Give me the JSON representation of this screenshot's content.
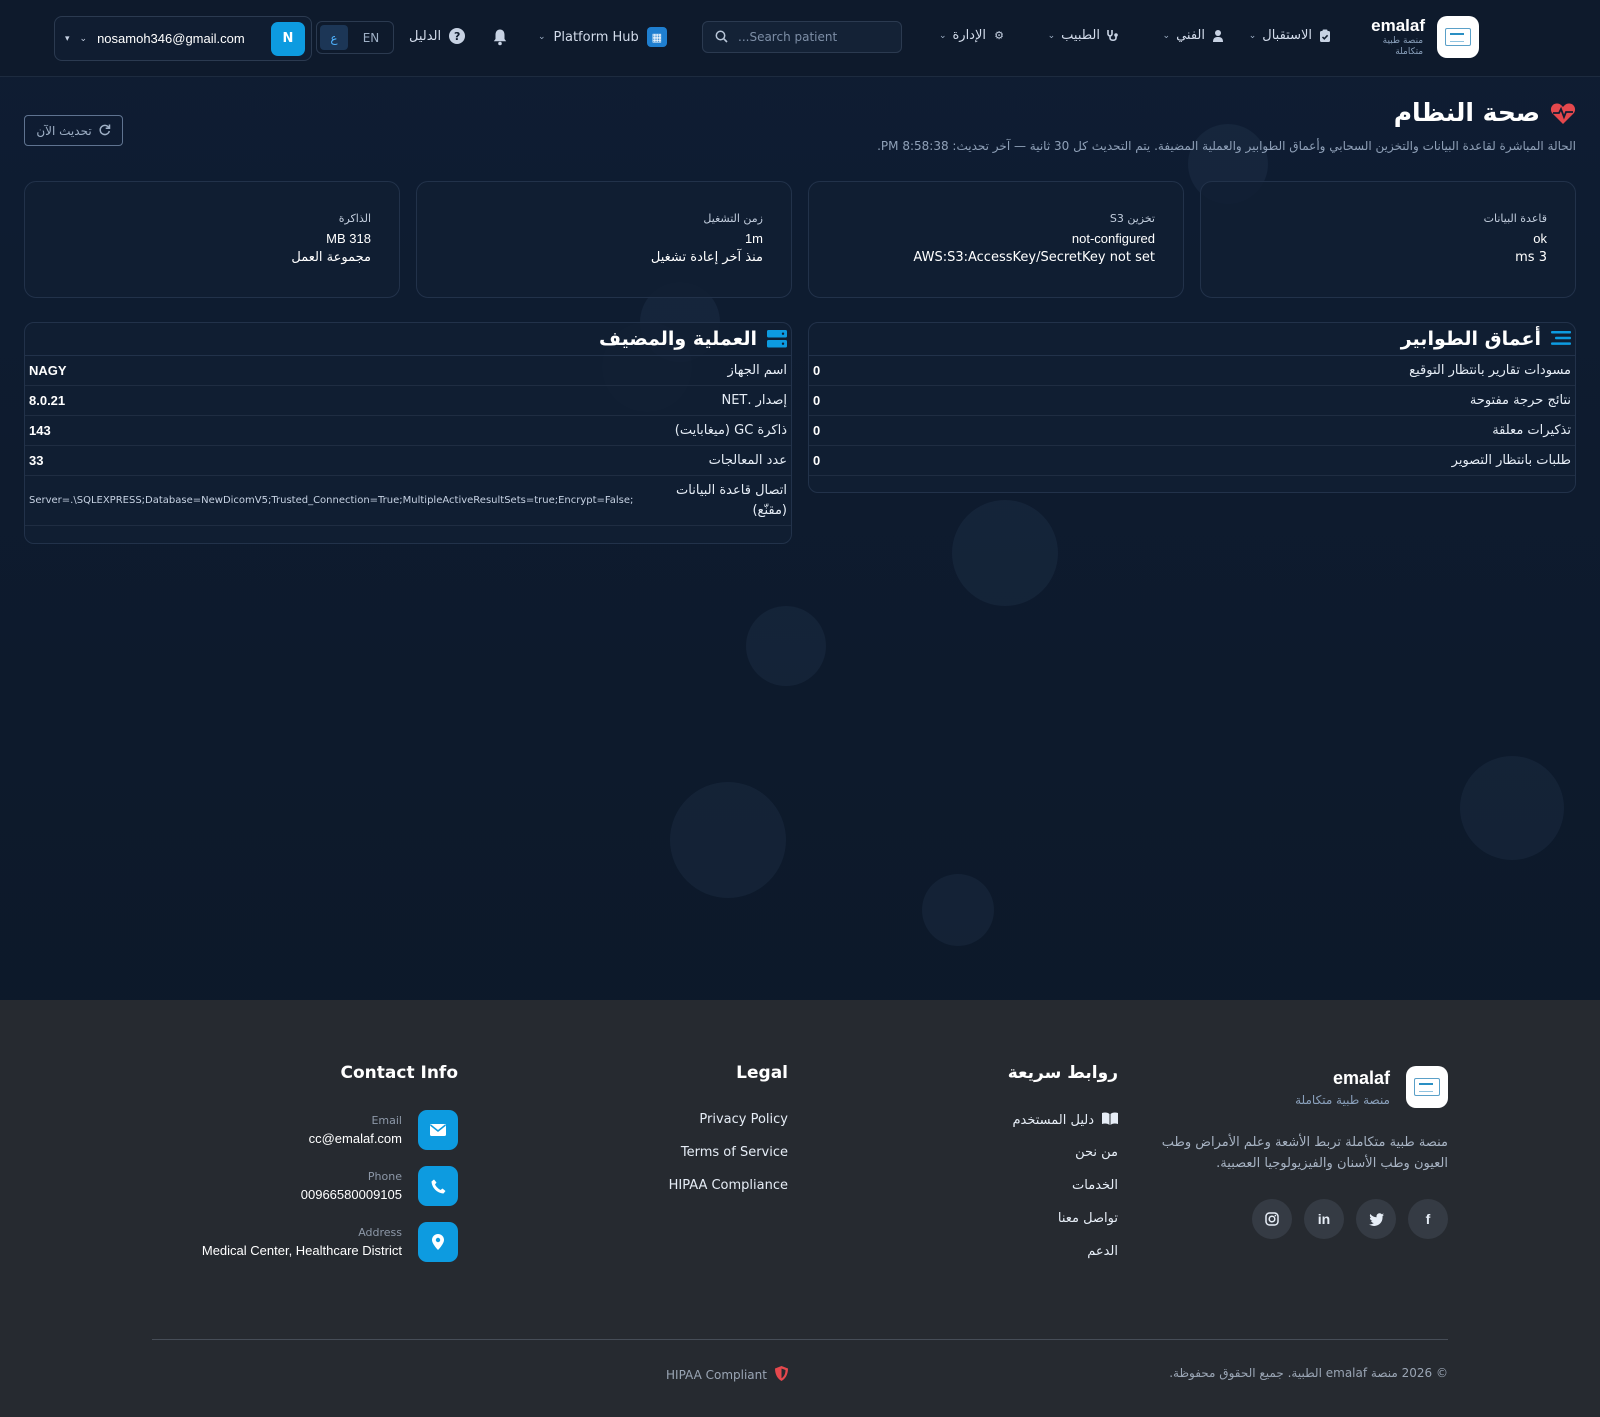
{
  "header": {
    "brand_name": "emalaf",
    "brand_sub": "منصة طبية متكاملة",
    "nav": [
      {
        "label": "الاستقبال",
        "icon": "clipboard-check-icon"
      },
      {
        "label": "الفني",
        "icon": "user-tie-icon"
      },
      {
        "label": "الطبيب",
        "icon": "stethoscope-icon"
      },
      {
        "label": "الإدارة",
        "icon": "gear-icon"
      }
    ],
    "search_placeholder": "Search patient...",
    "platform_hub": "Platform Hub",
    "guide": "الدليل",
    "lang_ar": "ع",
    "lang_en": "EN",
    "user_email": "nosamoh346@gmail.com",
    "user_initial": "N"
  },
  "page": {
    "title": "صحة النظام",
    "subtitle": "الحالة المباشرة لقاعدة البيانات والتخزين السحابي وأعماق الطوابير والعملية المضيفة. يتم التحديث كل 30 ثانية — آخر تحديث: 8:58:38 PM.",
    "refresh_label": "تحديث الآن"
  },
  "cards": {
    "database": {
      "label": "قاعدة البيانات",
      "value": "ok",
      "note": "3 ms"
    },
    "s3": {
      "label": "تخزين S3",
      "value": "not-configured",
      "note": "AWS:S3:AccessKey/SecretKey not set"
    },
    "uptime": {
      "label": "زمن التشغيل",
      "value": "1m",
      "note": "منذ آخر إعادة تشغيل"
    },
    "memory": {
      "label": "الذاكرة",
      "value": "318 MB",
      "note": "مجموعة العمل"
    }
  },
  "queues": {
    "title": "أعماق الطوابير",
    "rows": [
      {
        "k": "مسودات تقارير بانتظار التوقيع",
        "v": "0"
      },
      {
        "k": "نتائج حرجة مفتوحة",
        "v": "0"
      },
      {
        "k": "تذكيرات معلقة",
        "v": "0"
      },
      {
        "k": "طلبات بانتظار التصوير",
        "v": "0"
      }
    ]
  },
  "host": {
    "title": "العملية والمضيف",
    "rows": [
      {
        "k": "اسم الجهاز",
        "v": "NAGY"
      },
      {
        "k": "إصدار .NET",
        "v": "8.0.21"
      },
      {
        "k": "ذاكرة GC (ميغابايت)",
        "v": "143"
      },
      {
        "k": "عدد المعالجات",
        "v": "33"
      },
      {
        "k": "اتصال قاعدة البيانات (مقنّع)",
        "v": "Server=.\\SQLEXPRESS;Database=NewDicomV5;Trusted_Connection=True;MultipleActiveResultSets=true;Encrypt=False;"
      }
    ]
  },
  "footer": {
    "brand_name": "emalaf",
    "brand_sub": "منصة طبية متكاملة",
    "description": "منصة طبية متكاملة تربط الأشعة وعلم الأمراض وطب العيون وطب الأسنان والفيزيولوجيا العصبية.",
    "quick_links_title": "روابط سريعة",
    "quick_links": [
      "دليل المستخدم",
      "من نحن",
      "الخدمات",
      "تواصل معنا",
      "الدعم"
    ],
    "legal_title": "Legal",
    "legal_links": [
      "Privacy Policy",
      "Terms of Service",
      "HIPAA Compliance"
    ],
    "contact_title": "Contact Info",
    "contact": {
      "email_label": "Email",
      "email": "cc@emalaf.com",
      "phone_label": "Phone",
      "phone": "00966580009105",
      "address_label": "Address",
      "address": "Medical Center, Healthcare District"
    },
    "socials": [
      "facebook-icon",
      "twitter-icon",
      "linkedin-icon",
      "instagram-icon"
    ],
    "copyright": "© 2026 منصة emalaf الطبية. جميع الحقوق محفوظة.",
    "hipaa": "HIPAA Compliant"
  },
  "colors": {
    "accent": "#0d9be0",
    "danger": "#e5484d",
    "background": "#0f1b2c",
    "footer": "#262a30"
  }
}
